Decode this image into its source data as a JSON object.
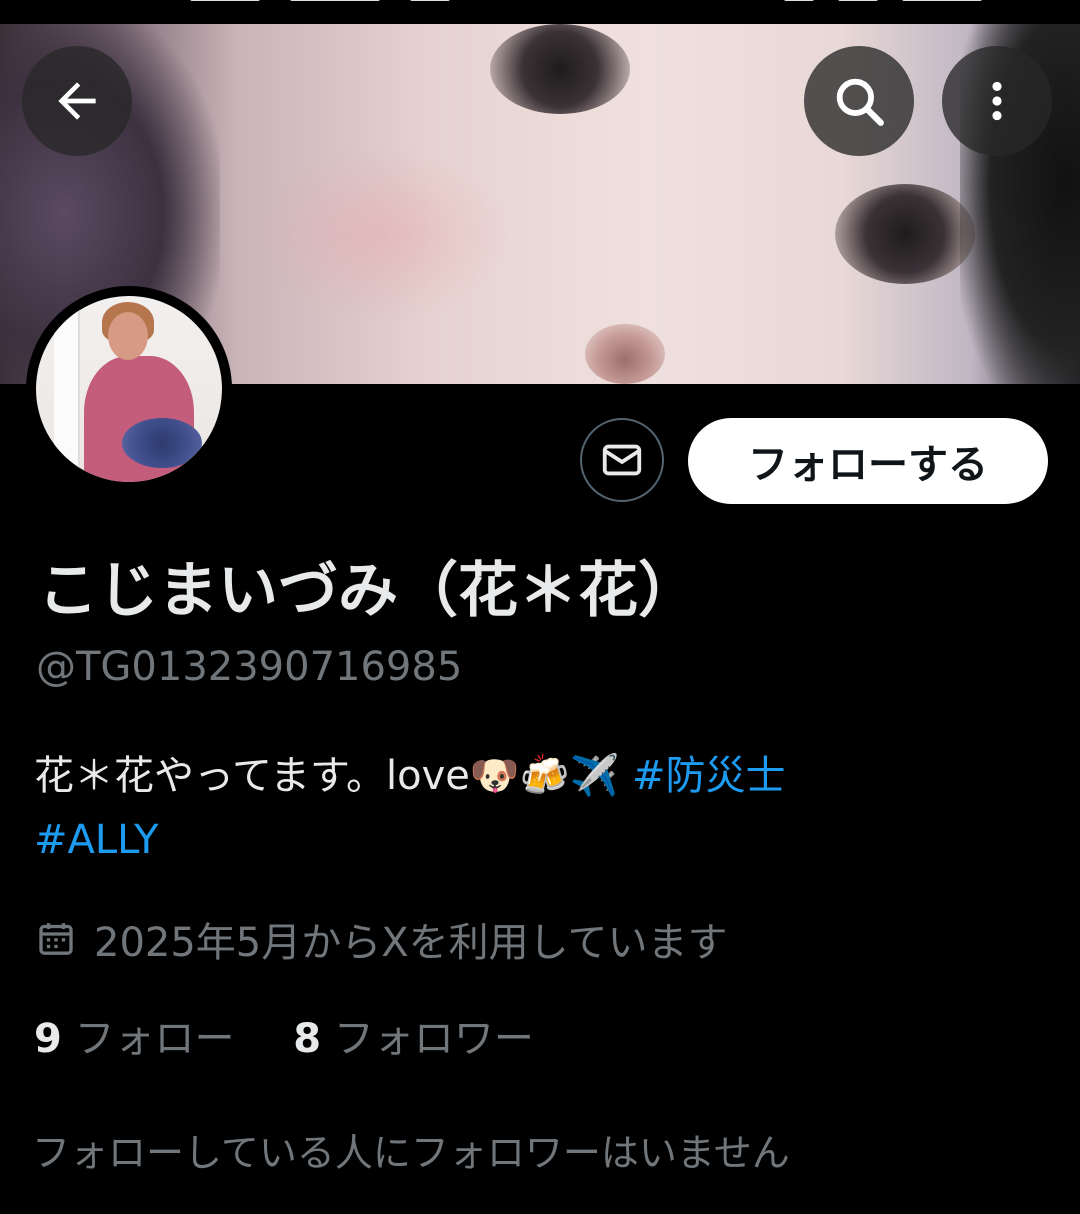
{
  "profile": {
    "display_name": "こじまいづみ（花＊花）",
    "handle": "@TG0132390716985",
    "bio_text": "花＊花やってます。love🐶🍻✈️ ",
    "bio_tag_1": "#防災士",
    "bio_tag_2": "#ALLY",
    "joined": "2025年5月からXを利用しています",
    "following_count": "9",
    "following_label": "フォロー",
    "followers_count": "8",
    "followers_label": "フォロワー",
    "mutuals_notice": "フォローしている人にフォロワーはいません"
  },
  "actions": {
    "follow_label": "フォローする"
  },
  "icons": {
    "back": "arrow-left-icon",
    "search": "search-icon",
    "more": "more-vertical-icon",
    "message": "mail-icon",
    "calendar": "calendar-icon"
  },
  "colors": {
    "background": "#000000",
    "primary_text": "#e7e9ea",
    "secondary_text": "#71767b",
    "link": "#1d9bf0",
    "follow_button_bg": "#ffffff"
  }
}
